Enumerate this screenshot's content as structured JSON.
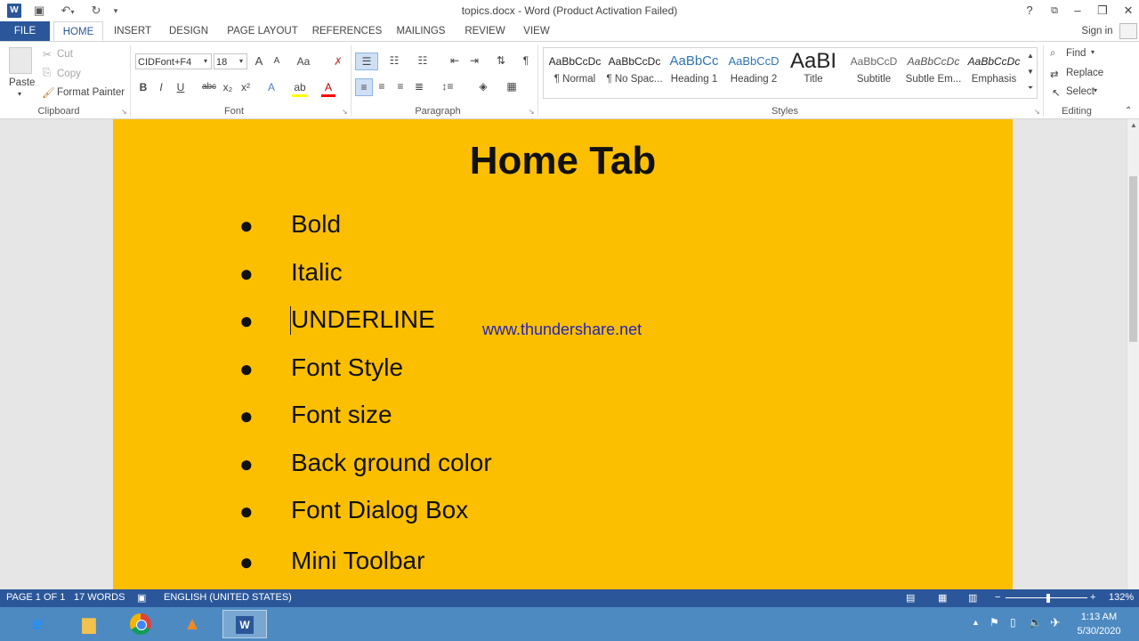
{
  "window": {
    "title": "topics.docx - Word (Product Activation Failed)",
    "help": "?",
    "sign_in": "Sign in"
  },
  "tabs": [
    "FILE",
    "HOME",
    "INSERT",
    "DESIGN",
    "PAGE LAYOUT",
    "REFERENCES",
    "MAILINGS",
    "REVIEW",
    "VIEW"
  ],
  "clipboard": {
    "paste": "Paste",
    "cut": "Cut",
    "copy": "Copy",
    "format_painter": "Format Painter",
    "label": "Clipboard"
  },
  "font": {
    "name": "CIDFont+F4",
    "size": "18",
    "label": "Font",
    "bold": "B",
    "italic": "I",
    "underline": "U",
    "strike": "abc",
    "subscript": "x₂",
    "superscript": "x²",
    "grow": "A",
    "shrink": "A",
    "change_case": "Aa",
    "text_effects": "A",
    "font_color": "A"
  },
  "paragraph": {
    "label": "Paragraph"
  },
  "styles": {
    "label": "Styles",
    "items": [
      {
        "preview": "AaBbCcDc",
        "name": "¶ Normal"
      },
      {
        "preview": "AaBbCcDc",
        "name": "¶ No Spac..."
      },
      {
        "preview": "AaBbCc",
        "name": "Heading 1"
      },
      {
        "preview": "AaBbCcD",
        "name": "Heading 2"
      },
      {
        "preview": "AaBI",
        "name": "Title"
      },
      {
        "preview": "AaBbCcD",
        "name": "Subtitle"
      },
      {
        "preview": "AaBbCcDc",
        "name": "Subtle Em..."
      },
      {
        "preview": "AaBbCcDc",
        "name": "Emphasis"
      }
    ]
  },
  "editing": {
    "find": "Find",
    "replace": "Replace",
    "select": "Select",
    "label": "Editing"
  },
  "document": {
    "title": "Home Tab",
    "items": [
      "Bold",
      "Italic",
      "UNDERLINE",
      "Font Style",
      "Font size",
      "Back ground color",
      "Font Dialog Box",
      "Mini Toolbar"
    ],
    "watermark": "www.thundershare.net"
  },
  "status": {
    "page": "PAGE 1 OF 1",
    "words": "17 WORDS",
    "language": "ENGLISH (UNITED STATES)",
    "zoom": "132%"
  },
  "taskbar": {
    "time": "1:13 AM",
    "date": "5/30/2020"
  },
  "colors": {
    "accent": "#2b579a",
    "page_bg": "#fcbf00",
    "taskbar": "#4d8ac2"
  }
}
